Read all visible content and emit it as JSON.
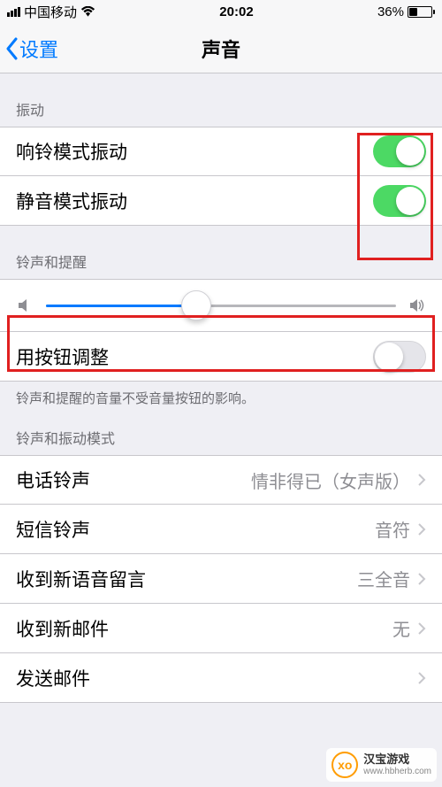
{
  "status": {
    "carrier": "中国移动",
    "time": "20:02",
    "battery_pct": "36%"
  },
  "nav": {
    "back_label": "设置",
    "title": "声音"
  },
  "sections": {
    "vibration": {
      "header": "振动",
      "ring_vibrate": "响铃模式振动",
      "silent_vibrate": "静音模式振动"
    },
    "ring_alert": {
      "header": "铃声和提醒",
      "slider_value": 0.43,
      "button_adjust": "用按钮调整",
      "footer": "铃声和提醒的音量不受音量按钮的影响。"
    },
    "patterns": {
      "header": "铃声和振动模式",
      "items": [
        {
          "label": "电话铃声",
          "value": "情非得已（女声版）"
        },
        {
          "label": "短信铃声",
          "value": "音符"
        },
        {
          "label": "收到新语音留言",
          "value": "三全音"
        },
        {
          "label": "收到新邮件",
          "value": "无"
        },
        {
          "label": "发送邮件",
          "value": ""
        }
      ]
    }
  },
  "watermark": {
    "logo": "xo",
    "title": "汉宝游戏",
    "url": "www.hbherb.com"
  }
}
